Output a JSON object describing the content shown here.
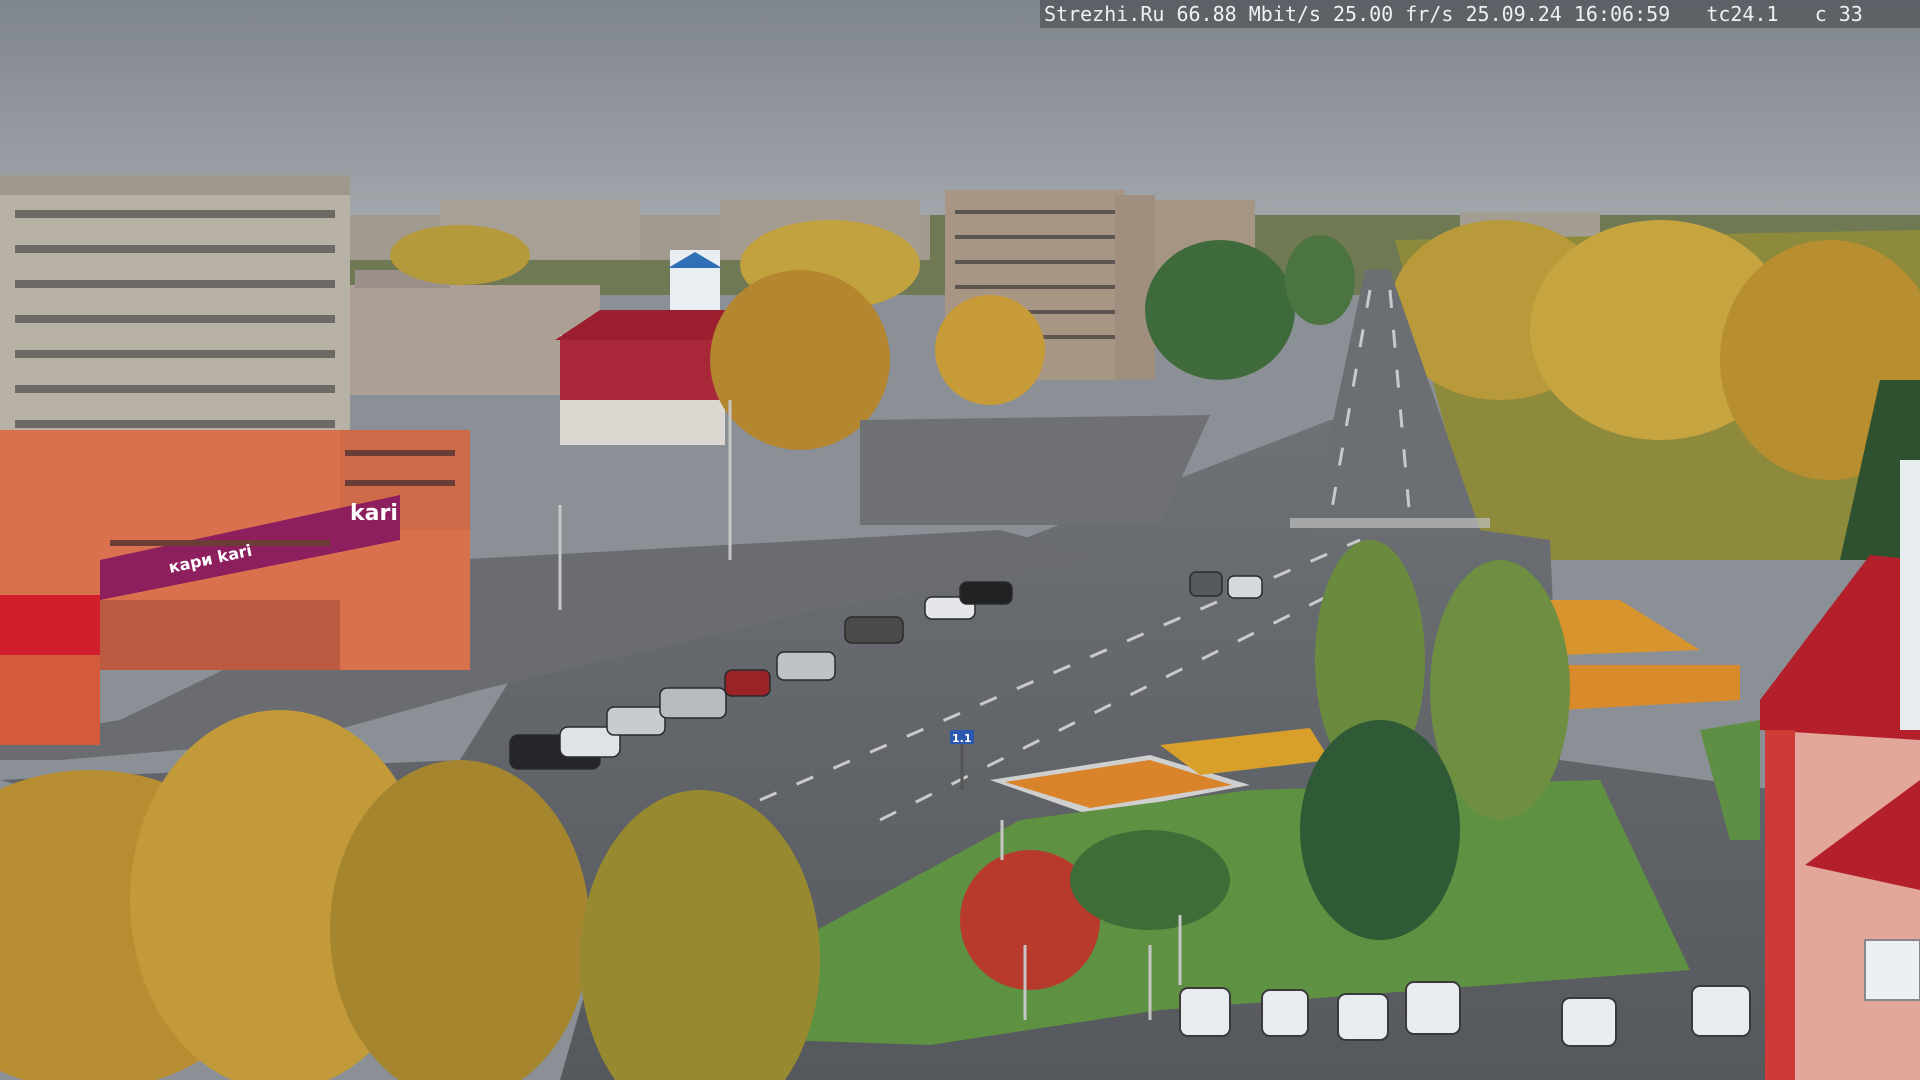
{
  "overlay": {
    "site": "Strezhi.Ru",
    "bitrate": "66.88 Mbit/s",
    "fps": "25.00 fr/s",
    "date": "25.09.24",
    "time": "16:06:59",
    "camera": "tc24.1",
    "counter": "c 33"
  },
  "signs": {
    "store_main": "kari",
    "store_secondary": "кари kari",
    "street_sign": "1.1"
  },
  "colors": {
    "sky": "#8d9299",
    "asphalt": "#5f6266",
    "store_magenta": "#8e1f5e",
    "brick_orange": "#d9714f",
    "roof_red": "#b3202c"
  }
}
